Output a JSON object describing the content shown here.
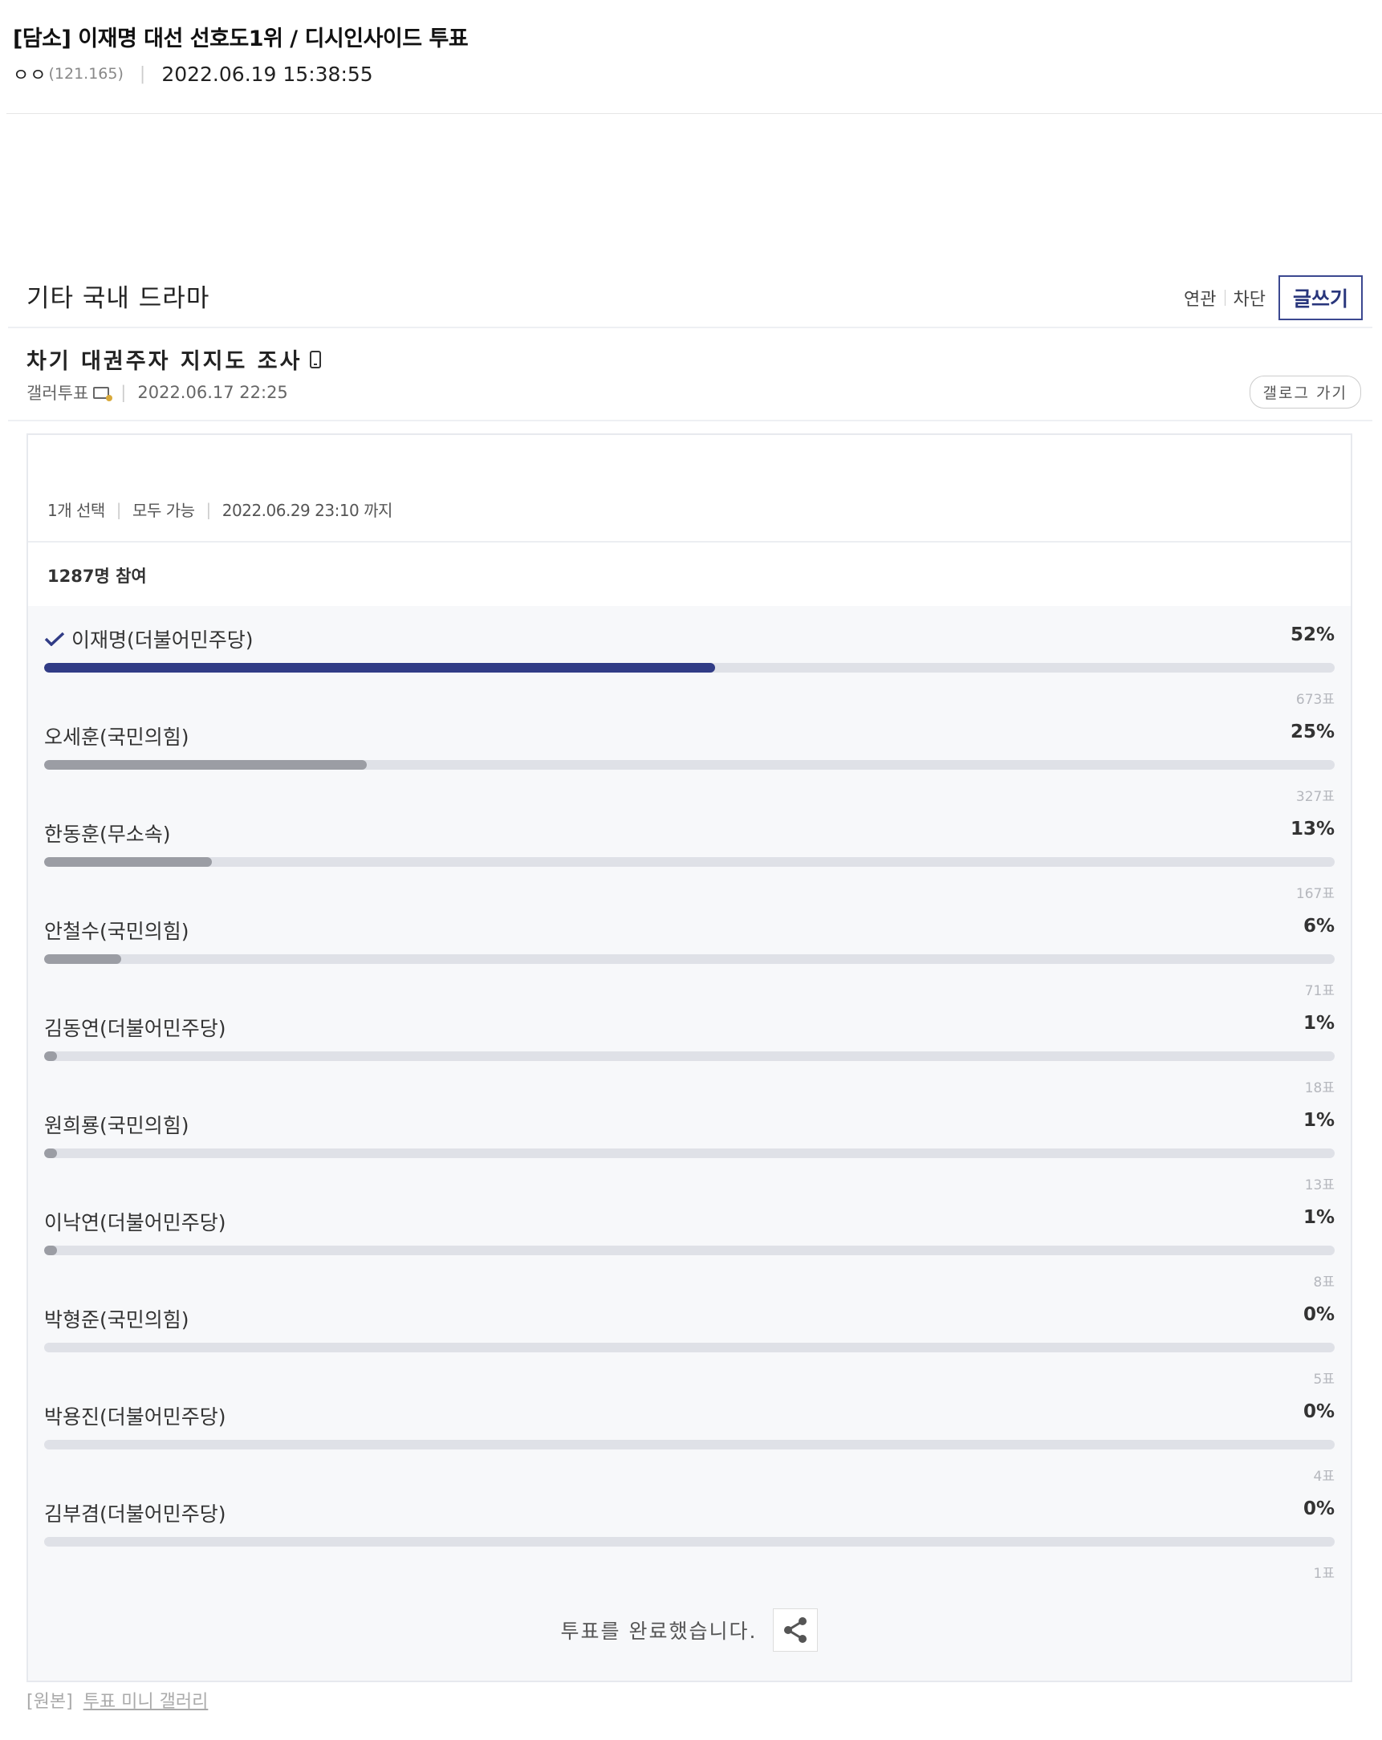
{
  "post": {
    "title": "[담소] 이재명 대선 선호도1위 / 디시인사이드 투표",
    "author": "ㅇㅇ",
    "author_id": "(121.165)",
    "date": "2022.06.19 15:38:55"
  },
  "gallery": {
    "name": "기타 국내 드라마",
    "link_related": "연관",
    "link_block": "차단",
    "write_label": "글쓰기"
  },
  "vote_post": {
    "title": "차기 대권주자 지지도 조사",
    "category": "갤러투표",
    "date": "2022.06.17 22:25",
    "go_gallery": "갤로그 가기"
  },
  "poll": {
    "select_rule": "1개 선택",
    "visibility": "모두 가능",
    "deadline": "2022.06.29 23:10 까지",
    "participants": "1287명 참여",
    "done_text": "투표를 완료했습니다.",
    "options": [
      {
        "label": "이재명(더불어민주당)",
        "pct_text": "52%",
        "votes_text": "673표",
        "pct": 52,
        "selected": true
      },
      {
        "label": "오세훈(국민의힘)",
        "pct_text": "25%",
        "votes_text": "327표",
        "pct": 25,
        "selected": false
      },
      {
        "label": "한동훈(무소속)",
        "pct_text": "13%",
        "votes_text": "167표",
        "pct": 13,
        "selected": false
      },
      {
        "label": "안철수(국민의힘)",
        "pct_text": "6%",
        "votes_text": "71표",
        "pct": 6,
        "selected": false
      },
      {
        "label": "김동연(더불어민주당)",
        "pct_text": "1%",
        "votes_text": "18표",
        "pct": 1,
        "selected": false
      },
      {
        "label": "원희룡(국민의힘)",
        "pct_text": "1%",
        "votes_text": "13표",
        "pct": 1,
        "selected": false
      },
      {
        "label": "이낙연(더불어민주당)",
        "pct_text": "1%",
        "votes_text": "8표",
        "pct": 1,
        "selected": false
      },
      {
        "label": "박형준(국민의힘)",
        "pct_text": "0%",
        "votes_text": "5표",
        "pct": 0,
        "selected": false
      },
      {
        "label": "박용진(더불어민주당)",
        "pct_text": "0%",
        "votes_text": "4표",
        "pct": 0,
        "selected": false
      },
      {
        "label": "김부겸(더불어민주당)",
        "pct_text": "0%",
        "votes_text": "1표",
        "pct": 0,
        "selected": false
      }
    ]
  },
  "source": {
    "prefix": "[원본]",
    "link": "투표 미니 갤러리"
  },
  "colors": {
    "selected_bar": "#313c86",
    "other_bar": "#9b9da4",
    "track": "#dfe1e7",
    "write_button_border": "#3b4890"
  },
  "icons": {
    "selected_marker": "check-icon",
    "share": "share-icon",
    "mobile": "phone-icon",
    "category": "camera-icon"
  }
}
